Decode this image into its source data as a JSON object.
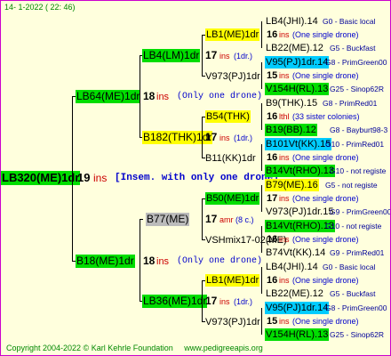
{
  "header": {
    "date": "14-  1-2022 ( 22: 46)"
  },
  "footer": {
    "copyright": "Copyright 2004-2022 © Karl Kehrle Foundation",
    "url": "www.pedigreeapis.org"
  },
  "root": {
    "id": "LB320(ME)1dr",
    "num": "19",
    "ins": "ins",
    "note": "[Insem. with only one drone]"
  },
  "gen1": [
    {
      "id": "LB64(ME)1dr",
      "num": "18",
      "ins": "ins",
      "note": "(Only one drone)"
    },
    {
      "id": "B18(ME)1dr",
      "num": "18",
      "ins": "ins",
      "note": "(Only one drone)"
    }
  ],
  "gen2": [
    {
      "id": "LB4(LM)1dr",
      "num": "17",
      "ins": "ins",
      "note": "(1dr.)"
    },
    {
      "id": "B182(THK)1dr",
      "num": "17",
      "ins": "ins",
      "note": "(1dr.)"
    },
    {
      "id": "B77(ME)",
      "num": "17",
      "ins": "amr",
      "note": "(8 c.)"
    },
    {
      "id": "LB36(ME)1dr",
      "num": "17",
      "ins": "ins",
      "note": "(1dr.)"
    }
  ],
  "gen3": [
    {
      "id": "LB1(ME)1dr",
      "sub": "V973(PJ)1dr"
    },
    {
      "id": "B54(THK)",
      "sub": "B11(KK)1dr"
    },
    {
      "id": "B50(ME)1dr",
      "sub": "VSHmix17-02(ME)"
    },
    {
      "id": "LB1(ME)1dr",
      "sub": "V973(PJ)1dr"
    }
  ],
  "gen4": [
    {
      "a": "LB4(JHI).14",
      "aNote": "G0 - Basic local",
      "num": "16",
      "ins": "ins",
      "note": "(One single drone)",
      "b": "LB22(ME).12",
      "bNote": "G5 - Buckfast"
    },
    {
      "a": "V95(PJ)1dr.14",
      "aNote": "G8 - PrimGreen00",
      "num": "15",
      "ins": "ins",
      "note": "(One single drone)",
      "b": "V154H(RL).13",
      "bNote": "G25 - Sinop62R"
    },
    {
      "a": "B9(THK).15",
      "aNote": "G8 - PrimRed01",
      "num": "16",
      "ins": "lthl",
      "note": "(33 sister colonies)",
      "b": "B19(BB).12",
      "bNote": "G8 - Bayburt98-3"
    },
    {
      "a": "B101Vt(KK).15",
      "aNote": "G10 - PrimRed01",
      "num": "16",
      "ins": "ins",
      "note": "(One single drone)",
      "b": "B14Vt(RHO).13",
      "bNote": "G10 - not registe"
    },
    {
      "a": "B79(ME).16",
      "aNote": "G5 - not registe",
      "num": "17",
      "ins": "ins",
      "note": "(One single drone)",
      "b": "V973(PJ)1dr.15",
      "bNote": "G9 - PrimGreen00"
    },
    {
      "a": "B14Vt(RHO).13",
      "aNote": "G10 - not registe",
      "num": "16",
      "ins": "ins",
      "note": "(One single drone)",
      "b": "B74Vt(KK).14",
      "bNote": "G9 - PrimRed01"
    },
    {
      "a": "LB4(JHI).14",
      "aNote": "G0 - Basic local",
      "num": "16",
      "ins": "ins",
      "note": "(One single drone)",
      "b": "LB22(ME).12",
      "bNote": "G5 - Buckfast"
    },
    {
      "a": "V95(PJ)1dr.14",
      "aNote": "G8 - PrimGreen00",
      "num": "15",
      "ins": "ins",
      "note": "(One single drone)",
      "b": "V154H(RL).13",
      "bNote": "G25 - Sinop62R"
    }
  ]
}
